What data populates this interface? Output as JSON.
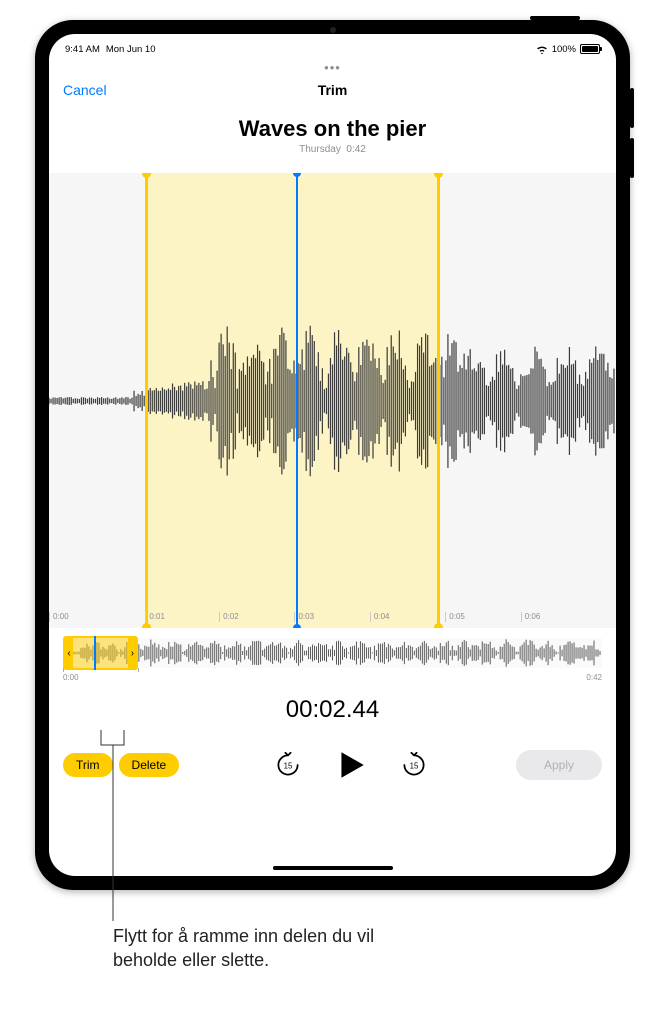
{
  "status": {
    "time": "9:41 AM",
    "date": "Mon Jun 10",
    "battery_pct": "100%"
  },
  "nav": {
    "cancel": "Cancel",
    "title": "Trim"
  },
  "recording": {
    "title": "Waves on the pier",
    "day": "Thursday",
    "duration": "0:42"
  },
  "ruler": {
    "ticks": [
      "0:00",
      "0:01",
      "0:02",
      "0:03",
      "0:04",
      "0:05",
      "0:06"
    ]
  },
  "overview": {
    "start": "0:00",
    "end": "0:42"
  },
  "timecode": "00:02.44",
  "buttons": {
    "trim": "Trim",
    "delete": "Delete",
    "apply": "Apply",
    "skip_back_seconds": "15",
    "skip_fwd_seconds": "15"
  },
  "callout": {
    "text": "Flytt for å ramme inn delen du vil beholde eller slette."
  }
}
